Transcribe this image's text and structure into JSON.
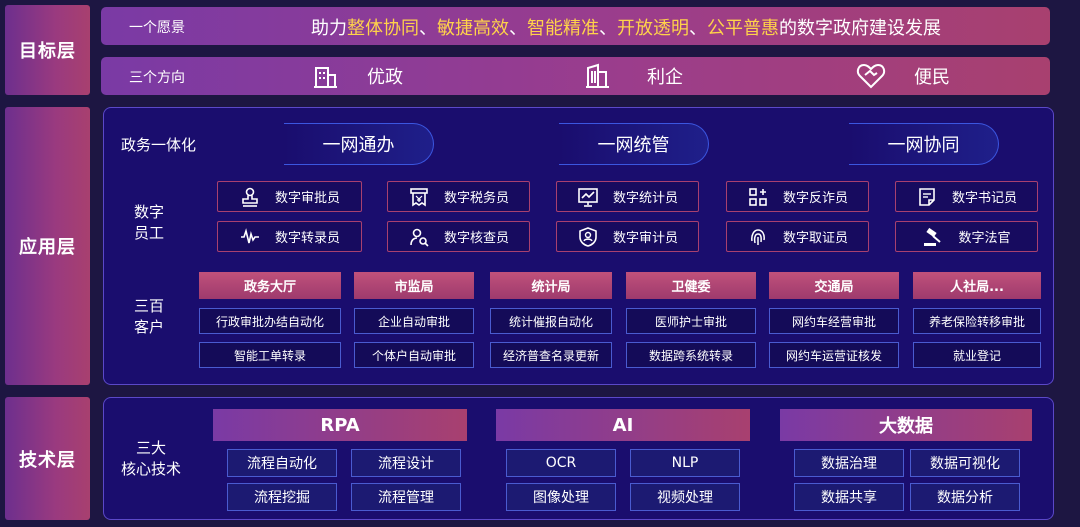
{
  "layers": {
    "goal": "目标层",
    "app": "应用层",
    "tech": "技术层"
  },
  "vision": {
    "label": "一个愿景",
    "text_parts": [
      "助力",
      "整体协同",
      "、",
      "敏捷高效",
      "、",
      "智能精准",
      "、",
      "开放透明",
      "、",
      "公平普惠",
      "的数字政府建设发展"
    ]
  },
  "directions": {
    "label": "三个方向",
    "items": [
      {
        "icon": "government-building-icon",
        "label": "优政"
      },
      {
        "icon": "office-building-icon",
        "label": "利企"
      },
      {
        "icon": "heart-handshake-icon",
        "label": "便民"
      }
    ]
  },
  "gov_integration": {
    "label": "政务一体化",
    "items": [
      "一网通办",
      "一网统管",
      "一网协同"
    ]
  },
  "digital_staff": {
    "label_lines": [
      "数字",
      "员工"
    ],
    "items": [
      {
        "icon": "stamp-icon",
        "label": "数字审批员"
      },
      {
        "icon": "receipt-icon",
        "label": "数字税务员"
      },
      {
        "icon": "chart-icon",
        "label": "数字统计员"
      },
      {
        "icon": "grid-plus-icon",
        "label": "数字反诈员"
      },
      {
        "icon": "document-icon",
        "label": "数字书记员"
      },
      {
        "icon": "waveform-icon",
        "label": "数字转录员"
      },
      {
        "icon": "person-search-icon",
        "label": "数字核查员"
      },
      {
        "icon": "shield-user-icon",
        "label": "数字审计员"
      },
      {
        "icon": "fingerprint-icon",
        "label": "数字取证员"
      },
      {
        "icon": "gavel-icon",
        "label": "数字法官"
      }
    ]
  },
  "customers": {
    "label_lines": [
      "三百",
      "客户"
    ],
    "departments": [
      {
        "name": "政务大厅",
        "cases": [
          "行政审批办结自动化",
          "智能工单转录"
        ]
      },
      {
        "name": "市监局",
        "cases": [
          "企业自动审批",
          "个体户自动审批"
        ]
      },
      {
        "name": "统计局",
        "cases": [
          "统计催报自动化",
          "经济普查名录更新"
        ]
      },
      {
        "name": "卫健委",
        "cases": [
          "医师护士审批",
          "数据跨系统转录"
        ]
      },
      {
        "name": "交通局",
        "cases": [
          "网约车经营审批",
          "网约车运营证核发"
        ]
      },
      {
        "name": "人社局...",
        "cases": [
          "养老保险转移审批",
          "就业登记"
        ]
      }
    ]
  },
  "tech": {
    "label_lines": [
      "三大",
      "核心技术"
    ],
    "groups": [
      {
        "name": "RPA",
        "items": [
          "流程自动化",
          "流程设计",
          "流程挖掘",
          "流程管理"
        ]
      },
      {
        "name": "AI",
        "items": [
          "OCR",
          "NLP",
          "图像处理",
          "视频处理"
        ]
      },
      {
        "name": "大数据",
        "items": [
          "数据治理",
          "数据可视化",
          "数据共享",
          "数据分析"
        ]
      }
    ]
  }
}
